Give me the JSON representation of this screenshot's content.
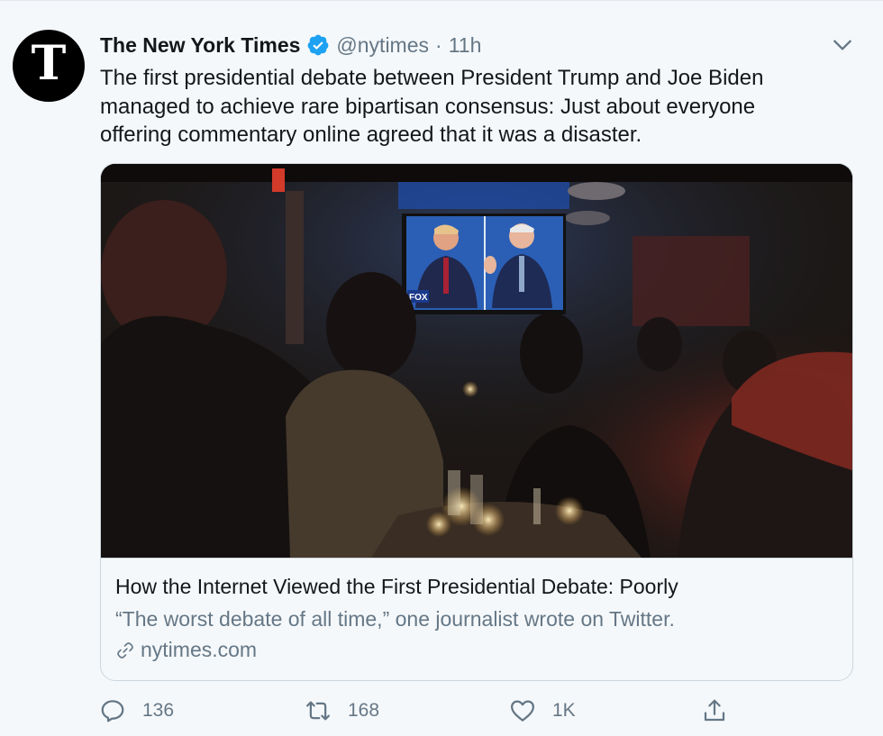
{
  "tweet": {
    "display_name": "The New York Times",
    "handle": "@nytimes",
    "separator": "·",
    "time": "11h",
    "avatar_letter": "T",
    "text": "The first presidential debate between President Trump and Joe Biden managed to achieve rare bipartisan consensus: Just about everyone offering commentary online agreed that it was a disaster."
  },
  "card": {
    "title": "How the Internet Viewed the First Presidential Debate: Poorly",
    "description": "“The worst debate of all time,” one journalist wrote on Twitter.",
    "domain": "nytimes.com",
    "image_tv_label": "FOX"
  },
  "actions": {
    "reply_count": "136",
    "retweet_count": "168",
    "like_count": "1K"
  },
  "icons": {
    "avatar": "nyt-logo-icon",
    "verified": "verified-badge-icon",
    "menu": "chevron-down-icon",
    "link": "link-icon",
    "reply": "reply-icon",
    "retweet": "retweet-icon",
    "like": "heart-icon",
    "share": "share-icon"
  },
  "colors": {
    "background": "#f5f8fa",
    "text": "#14171a",
    "secondary": "#657786",
    "verified": "#1da1f2"
  }
}
